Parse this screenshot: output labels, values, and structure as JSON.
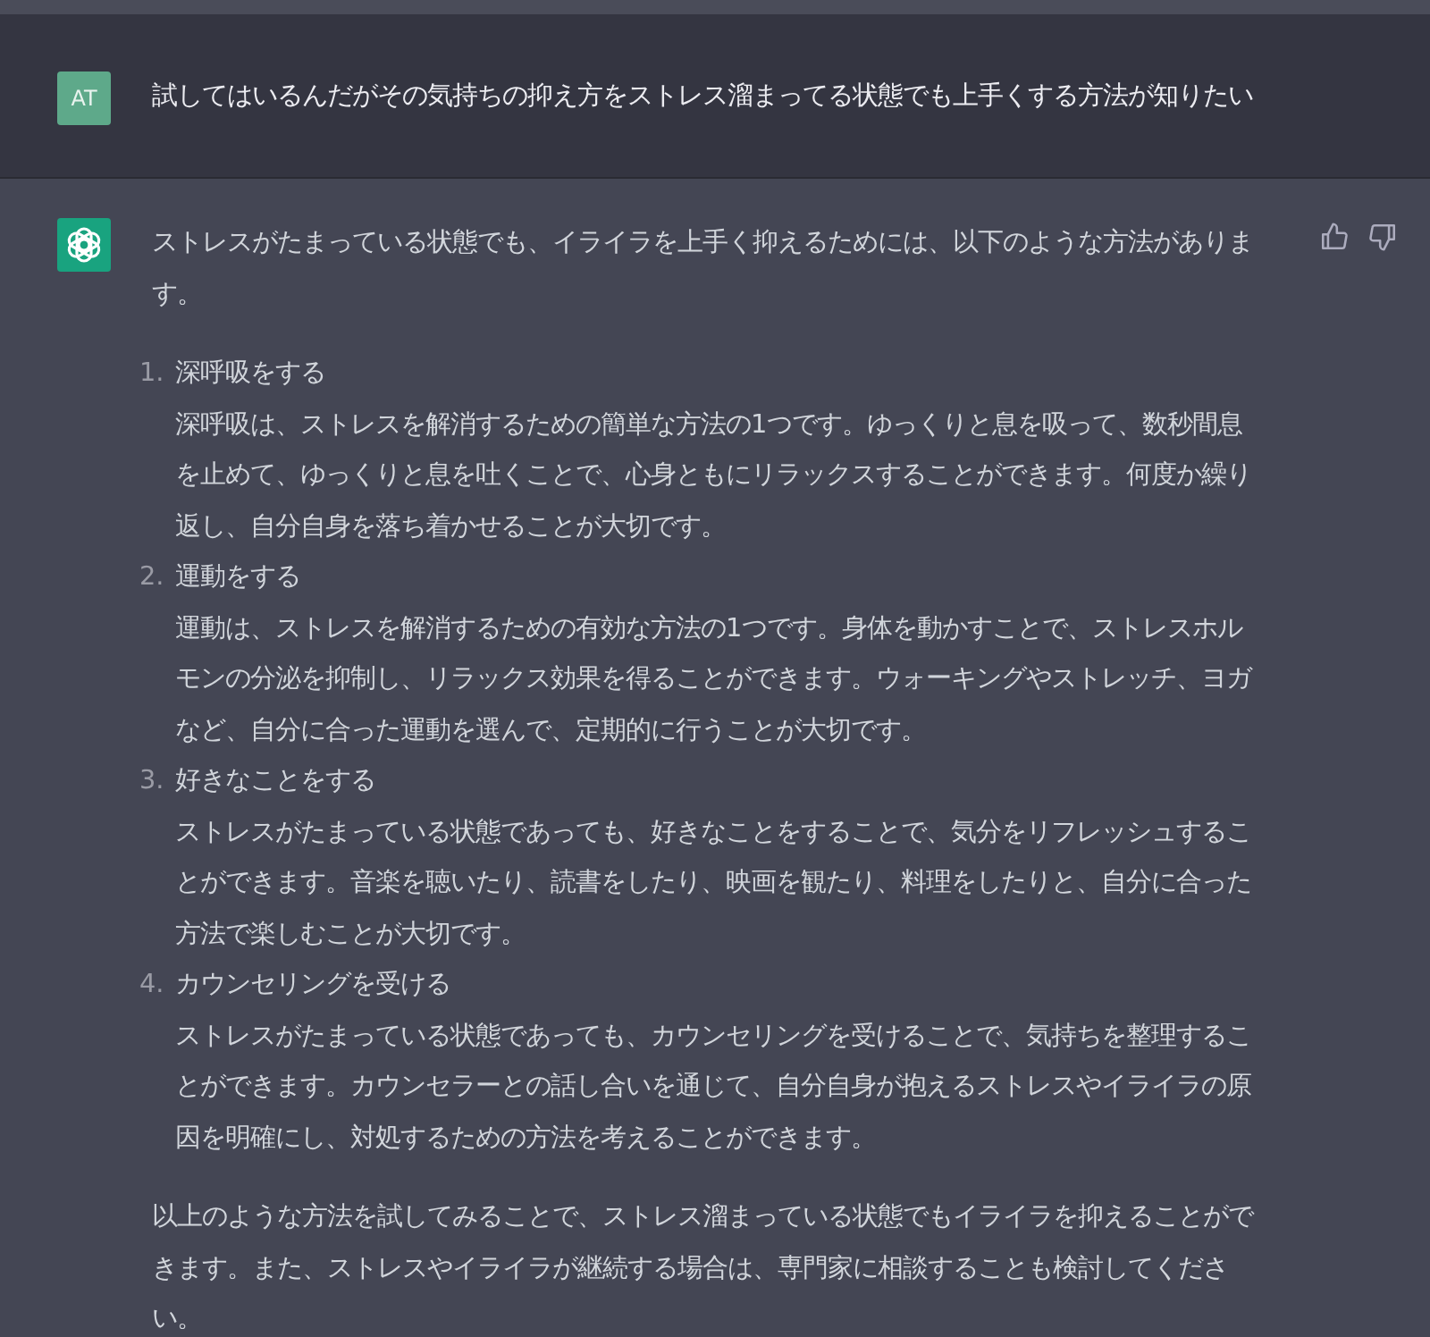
{
  "user_message": {
    "avatar": "AT",
    "text": "試してはいるんだがその気持ちの抑え方をストレス溜まってる状態でも上手くする方法が知りたい"
  },
  "assistant_message": {
    "intro": "ストレスがたまっている状態でも、イライラを上手く抑えるためには、以下のような方法があります。",
    "items": [
      {
        "number": "1.",
        "title": "深呼吸をする",
        "body": "深呼吸は、ストレスを解消するための簡単な方法の1つです。ゆっくりと息を吸って、数秒間息を止めて、ゆっくりと息を吐くことで、心身ともにリラックスすることができます。何度か繰り返し、自分自身を落ち着かせることが大切です。"
      },
      {
        "number": "2.",
        "title": "運動をする",
        "body": "運動は、ストレスを解消するための有効な方法の1つです。身体を動かすことで、ストレスホルモンの分泌を抑制し、リラックス効果を得ることができます。ウォーキングやストレッチ、ヨガなど、自分に合った運動を選んで、定期的に行うことが大切です。"
      },
      {
        "number": "3.",
        "title": "好きなことをする",
        "body": "ストレスがたまっている状態であっても、好きなことをすることで、気分をリフレッシュすることができます。音楽を聴いたり、読書をしたり、映画を観たり、料理をしたりと、自分に合った方法で楽しむことが大切です。"
      },
      {
        "number": "4.",
        "title": "カウンセリングを受ける",
        "body": "ストレスがたまっている状態であっても、カウンセリングを受けることで、気持ちを整理することができます。カウンセラーとの話し合いを通じて、自分自身が抱えるストレスやイライラの原因を明確にし、対処するための方法を考えることができます。"
      }
    ],
    "conclusion": "以上のような方法を試してみることで、ストレス溜まっている状態でもイライラを抑えることができます。また、ストレスやイライラが継続する場合は、専門家に相談することも検討してください。"
  }
}
